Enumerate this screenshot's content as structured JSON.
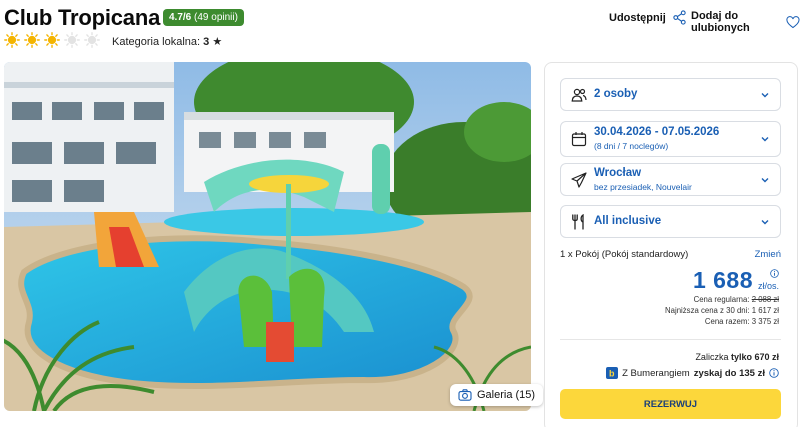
{
  "hotel": {
    "name": "Club Tropicana",
    "rating": "4.7/6",
    "reviews": "(49 opinii)",
    "suns_filled": 3,
    "suns_total": 5,
    "category_label": "Kategoria lokalna:",
    "category_value": "3"
  },
  "header_actions": {
    "share_label": "Udostępnij",
    "favorite_label": "Dodaj do ulubionych"
  },
  "gallery": {
    "label": "Galeria (15)"
  },
  "booking": {
    "guests": "2 osoby",
    "dates": "30.04.2026 - 07.05.2026",
    "duration": "(8 dni / 7 noclegów)",
    "departure": "Wrocław",
    "flight_info": "bez przesiadek, Nouvelair",
    "board": "All inclusive",
    "room": "1 x Pokój  (Pokój standardowy)",
    "change_label": "Zmień",
    "price": "1 688",
    "currency": "zł/os.",
    "regular_label": "Cena regularna:",
    "regular_price": "2 088 zł",
    "lowest_label": "Najniższa cena z 30 dni:",
    "lowest_price": "1 617 zł",
    "total_label": "Cena razem:",
    "total_price": "3 375 zł",
    "deposit_label": "Zaliczka",
    "deposit_value": "tylko 670 zł",
    "boomerang_prefix": "Z Bumerangiem",
    "boomerang_value": "zyskaj do 135 zł",
    "reserve_label": "REZERWUJ"
  },
  "colors": {
    "accent_blue": "#1a5fb4",
    "rating_green": "#3d8b2f",
    "sun_yellow": "#f4b400",
    "reserve_yellow": "#fcd73b"
  }
}
